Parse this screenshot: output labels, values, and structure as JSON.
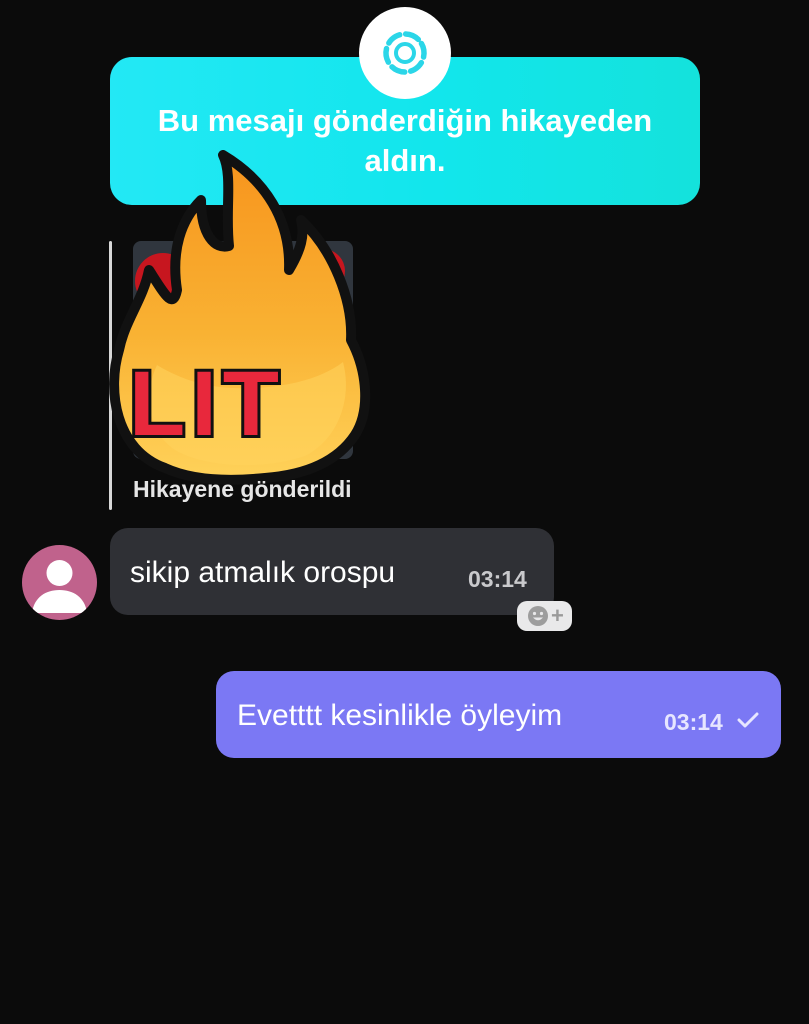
{
  "story_notice": {
    "text": "Bu mesajı gönderdiğin hikayeden aldın.",
    "badge_icon": "story-ring-icon"
  },
  "shared_story": {
    "sticker_text": "LIT",
    "sticker_icon": "fire-lit-sticker",
    "caption": "Hikayene gönderildi"
  },
  "messages": [
    {
      "direction": "incoming",
      "text": "sikip atmalık orospu",
      "time": "03:14",
      "avatar_icon": "default-user-avatar",
      "reaction_icon": "add-reaction-icon"
    },
    {
      "direction": "outgoing",
      "text": "Evetttt kesinlikle öyleyim",
      "time": "03:14",
      "status_icon": "read-check-icon"
    }
  ],
  "colors": {
    "background": "#0b0b0b",
    "notice_banner": "#14e2ec",
    "incoming_bubble": "#2f3035",
    "outgoing_bubble": "#7b78f4",
    "avatar": "#c0628c"
  }
}
